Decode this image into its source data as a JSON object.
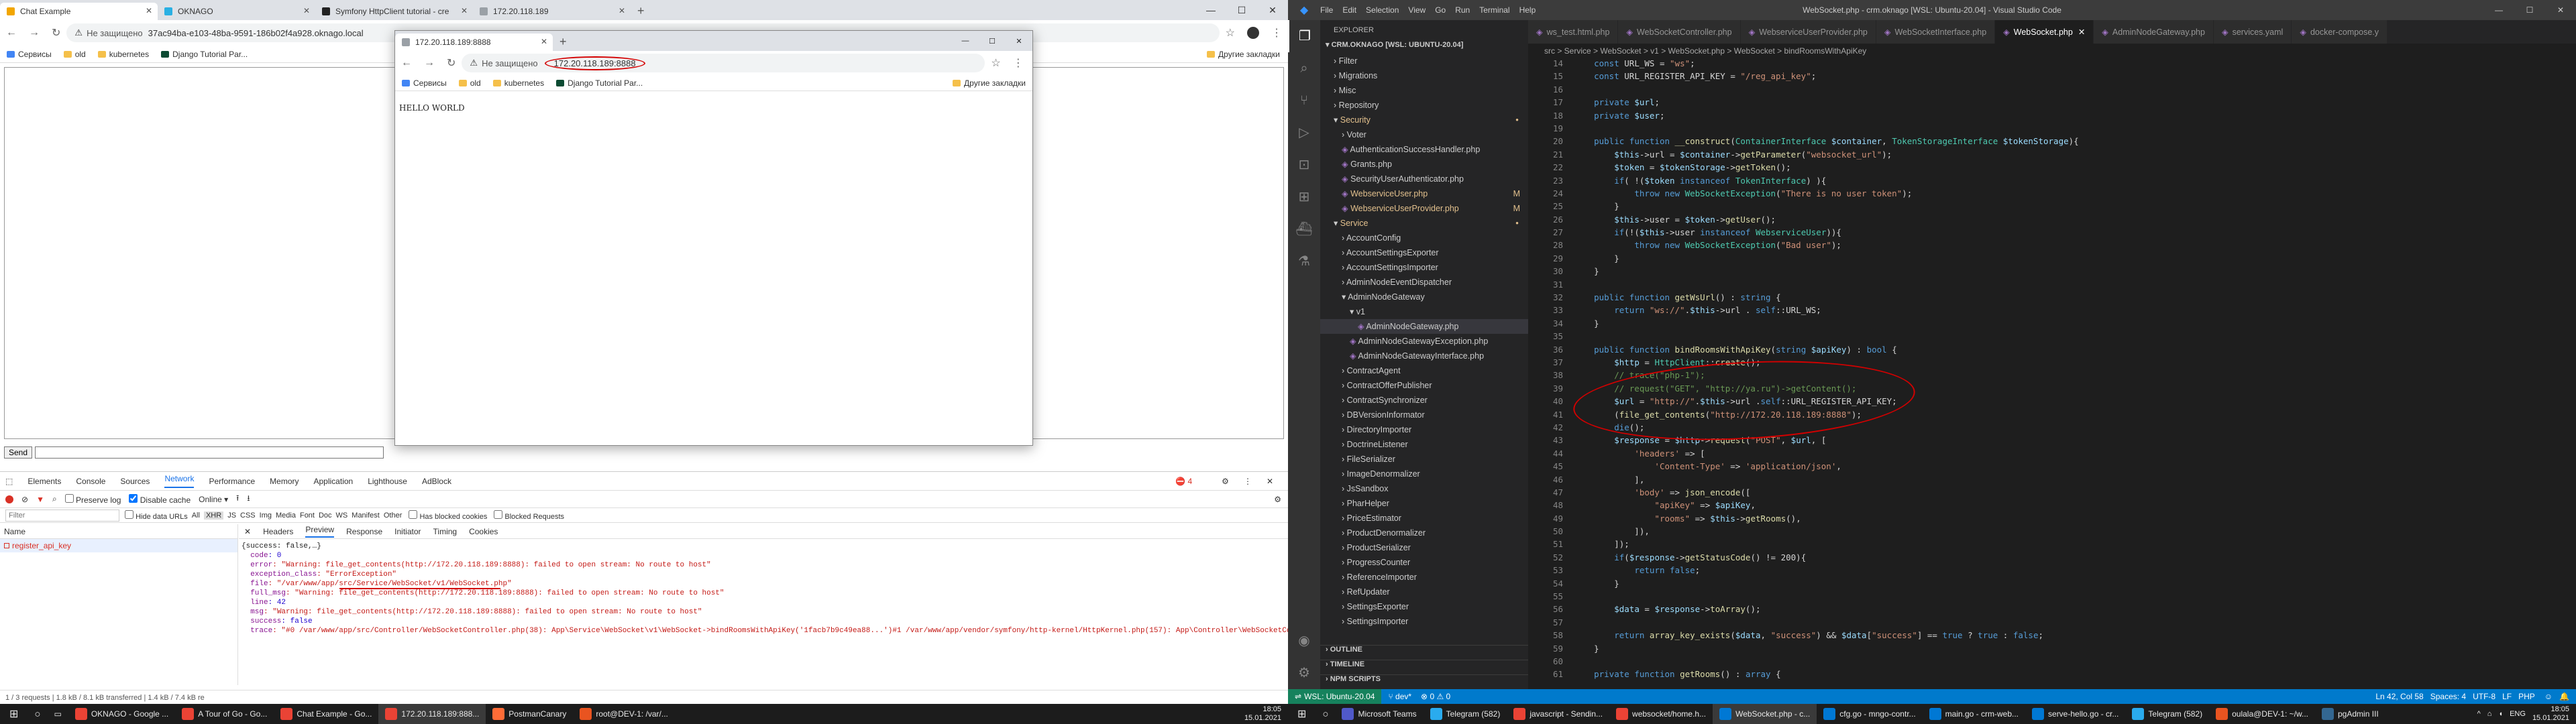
{
  "screen1": {
    "tabs": [
      {
        "title": "Chat Example",
        "active": true
      },
      {
        "title": "OKNAGO"
      },
      {
        "title": "Symfony HttpClient tutorial - cre"
      },
      {
        "title": "172.20.118.189"
      }
    ],
    "address": "37ac94ba-e103-48ba-9591-186b02f4a928.oknago.local",
    "security": "Не защищено",
    "bookmarks": [
      "Сервисы",
      "old",
      "kubernetes",
      "Django Tutorial Par..."
    ],
    "other_bookmarks": "Другие закладки",
    "send_label": "Send",
    "popup": {
      "tab_title": "172.20.118.189:8888",
      "security": "Не защищено",
      "address": "172.20.118.189:8888",
      "bookmarks": [
        "Сервисы",
        "old",
        "kubernetes",
        "Django Tutorial Par..."
      ],
      "other_bookmarks": "Другие закладки",
      "body_text": "HELLO WORLD"
    },
    "devtools": {
      "tabs": [
        "Elements",
        "Console",
        "Sources",
        "Network",
        "Performance",
        "Memory",
        "Application",
        "Lighthouse",
        "AdBlock"
      ],
      "active_tab": "Network",
      "toolbar": {
        "preserve_log": "Preserve log",
        "disable_cache": "Disable cache",
        "online": "Online"
      },
      "filter_placeholder": "Filter",
      "filter_types": [
        "Hide data URLs",
        "All",
        "XHR",
        "JS",
        "CSS",
        "Img",
        "Media",
        "Font",
        "Doc",
        "WS",
        "Manifest",
        "Other"
      ],
      "blocked_cookies": "Has blocked cookies",
      "blocked_requests": "Blocked Requests",
      "name_header": "Name",
      "requests": [
        "register_api_key"
      ],
      "detail_tabs": [
        "Headers",
        "Preview",
        "Response",
        "Initiator",
        "Timing",
        "Cookies"
      ],
      "active_detail": "Preview",
      "errors": "4",
      "preview_lines": [
        "{success: false,…}",
        "  code: 0",
        "  error: \"Warning: file_get_contents(http://172.20.118.189:8888): failed to open stream: No route to host\"",
        "  exception_class: \"ErrorException\"",
        "  file: \"/var/www/app/src/Service/WebSocket/v1/WebSocket.php\"",
        "  full_msg: \"Warning: file_get_contents(http://172.20.118.189:8888): failed to open stream: No route to host\"",
        "  line: 42",
        "  msg: \"Warning: file_get_contents(http://172.20.118.189:8888): failed to open stream: No route to host\"",
        "  success: false",
        "  trace: \"#0 /var/www/app/src/Controller/WebSocketController.php(38): App\\Service\\WebSocket\\v1\\WebSocket->bindRoomsWithApiKey('1facb7b9c49ea88...')#1 /var/www/app/vendor/symfony/http-kernel/HttpKernel.php(157): App\\Controller\\WebSocketContro"
      ],
      "status": "1 / 3 requests  |  1.8 kB / 8.1 kB transferred  |  1.4 kB / 7.4 kB re"
    },
    "taskbar": {
      "apps": [
        "OKNAGO - Google ...",
        "A Tour of Go - Go...",
        "Chat Example - Go...",
        "172.20.118.189:888...",
        "PostmanCanary",
        "root@DEV-1: /var/..."
      ],
      "time": "18:05",
      "date": "15.01.2021"
    }
  },
  "screen2": {
    "title": "WebSocket.php - crm.oknago [WSL: Ubuntu-20.04] - Visual Studio Code",
    "menu": [
      "File",
      "Edit",
      "Selection",
      "View",
      "Go",
      "Run",
      "Terminal",
      "Help"
    ],
    "explorer_label": "EXPLORER",
    "workspace": "CRM.OKNAGO [WSL: UBUNTU-20.04]",
    "tree": [
      {
        "label": "Filter",
        "depth": 1
      },
      {
        "label": "Migrations",
        "depth": 1
      },
      {
        "label": "Misc",
        "depth": 1
      },
      {
        "label": "Repository",
        "depth": 1
      },
      {
        "label": "Security",
        "depth": 1,
        "open": true,
        "git": true
      },
      {
        "label": "Voter",
        "depth": 2
      },
      {
        "label": "AuthenticationSuccessHandler.php",
        "depth": 2
      },
      {
        "label": "Grants.php",
        "depth": 2
      },
      {
        "label": "SecurityUserAuthenticator.php",
        "depth": 2
      },
      {
        "label": "WebserviceUser.php",
        "depth": 2,
        "git": true,
        "badge": "M"
      },
      {
        "label": "WebserviceUserProvider.php",
        "depth": 2,
        "git": true,
        "badge": "M"
      },
      {
        "label": "Service",
        "depth": 1,
        "open": true,
        "git": true
      },
      {
        "label": "AccountConfig",
        "depth": 2
      },
      {
        "label": "AccountSettingsExporter",
        "depth": 2
      },
      {
        "label": "AccountSettingsImporter",
        "depth": 2
      },
      {
        "label": "AdminNodeEventDispatcher",
        "depth": 2
      },
      {
        "label": "AdminNodeGateway",
        "depth": 2,
        "open": true
      },
      {
        "label": "v1",
        "depth": 3,
        "open": true
      },
      {
        "label": "AdminNodeGateway.php",
        "depth": 4,
        "selected": true
      },
      {
        "label": "AdminNodeGatewayException.php",
        "depth": 3
      },
      {
        "label": "AdminNodeGatewayInterface.php",
        "depth": 3
      },
      {
        "label": "ContractAgent",
        "depth": 2
      },
      {
        "label": "ContractOfferPublisher",
        "depth": 2
      },
      {
        "label": "ContractSynchronizer",
        "depth": 2
      },
      {
        "label": "DBVersionInformator",
        "depth": 2
      },
      {
        "label": "DirectoryImporter",
        "depth": 2
      },
      {
        "label": "DoctrineListener",
        "depth": 2
      },
      {
        "label": "FileSerializer",
        "depth": 2
      },
      {
        "label": "ImageDenormalizer",
        "depth": 2
      },
      {
        "label": "JsSandbox",
        "depth": 2
      },
      {
        "label": "PharHelper",
        "depth": 2
      },
      {
        "label": "PriceEstimator",
        "depth": 2
      },
      {
        "label": "ProductDenormalizer",
        "depth": 2
      },
      {
        "label": "ProductSerializer",
        "depth": 2
      },
      {
        "label": "ProgressCounter",
        "depth": 2
      },
      {
        "label": "ReferenceImporter",
        "depth": 2
      },
      {
        "label": "RefUpdater",
        "depth": 2
      },
      {
        "label": "SettingsExporter",
        "depth": 2
      },
      {
        "label": "SettingsImporter",
        "depth": 2
      }
    ],
    "outline": [
      "OUTLINE",
      "TIMELINE",
      "NPM SCRIPTS"
    ],
    "tabs": [
      {
        "title": "ws_test.html.php"
      },
      {
        "title": "WebSocketController.php"
      },
      {
        "title": "WebserviceUserProvider.php"
      },
      {
        "title": "WebSocketInterface.php"
      },
      {
        "title": "WebSocket.php",
        "active": true
      },
      {
        "title": "AdminNodeGateway.php"
      },
      {
        "title": "services.yaml"
      },
      {
        "title": "docker-compose.y"
      }
    ],
    "breadcrumb": "src > Service > WebSocket > v1 > WebSocket.php > WebSocket > bindRoomsWithApiKey",
    "code": [
      {
        "n": "14",
        "t": "    const URL_WS = \"ws\";"
      },
      {
        "n": "15",
        "t": "    const URL_REGISTER_API_KEY = \"/reg_api_key\";"
      },
      {
        "n": "16",
        "t": ""
      },
      {
        "n": "17",
        "t": "    private $url;"
      },
      {
        "n": "18",
        "t": "    private $user;"
      },
      {
        "n": "19",
        "t": ""
      },
      {
        "n": "20",
        "t": "    public function __construct(ContainerInterface $container, TokenStorageInterface $tokenStorage){"
      },
      {
        "n": "21",
        "t": "        $this->url = $container->getParameter(\"websocket_url\");"
      },
      {
        "n": "22",
        "t": "        $token = $tokenStorage->getToken();"
      },
      {
        "n": "23",
        "t": "        if( !($token instanceof TokenInterface) ){"
      },
      {
        "n": "24",
        "t": "            throw new WebSocketException(\"There is no user token\");"
      },
      {
        "n": "25",
        "t": "        }"
      },
      {
        "n": "26",
        "t": "        $this->user = $token->getUser();"
      },
      {
        "n": "27",
        "t": "        if(!($this->user instanceof WebserviceUser)){"
      },
      {
        "n": "28",
        "t": "            throw new WebSocketException(\"Bad user\");"
      },
      {
        "n": "29",
        "t": "        }"
      },
      {
        "n": "30",
        "t": "    }"
      },
      {
        "n": "31",
        "t": ""
      },
      {
        "n": "32",
        "t": "    public function getWsUrl() : string {"
      },
      {
        "n": "33",
        "t": "        return \"ws://\".$this->url . self::URL_WS;"
      },
      {
        "n": "34",
        "t": "    }"
      },
      {
        "n": "35",
        "t": ""
      },
      {
        "n": "36",
        "t": "    public function bindRoomsWithApiKey(string $apiKey) : bool {"
      },
      {
        "n": "37",
        "t": "        $http = HttpClient::create();"
      },
      {
        "n": "38",
        "t": "        // trace(\"php-1\");"
      },
      {
        "n": "39",
        "t": "        // request(\"GET\", \"http://ya.ru\")->getContent();"
      },
      {
        "n": "40",
        "t": "        $url = \"http://\".$this->url .self::URL_REGISTER_API_KEY;"
      },
      {
        "n": "41",
        "t": "        (file_get_contents(\"http://172.20.118.189:8888\");"
      },
      {
        "n": "42",
        "t": "        die();"
      },
      {
        "n": "43",
        "t": "        $response = $http->request(\"POST\", $url, ["
      },
      {
        "n": "44",
        "t": "            'headers' => ["
      },
      {
        "n": "45",
        "t": "                'Content-Type' => 'application/json',"
      },
      {
        "n": "46",
        "t": "            ],"
      },
      {
        "n": "47",
        "t": "            'body' => json_encode(["
      },
      {
        "n": "48",
        "t": "                \"apiKey\" => $apiKey,"
      },
      {
        "n": "49",
        "t": "                \"rooms\" => $this->getRooms(),"
      },
      {
        "n": "50",
        "t": "            ]),"
      },
      {
        "n": "51",
        "t": "        ]);"
      },
      {
        "n": "52",
        "t": "        if($response->getStatusCode() != 200){"
      },
      {
        "n": "53",
        "t": "            return false;"
      },
      {
        "n": "54",
        "t": "        }"
      },
      {
        "n": "55",
        "t": ""
      },
      {
        "n": "56",
        "t": "        $data = $response->toArray();"
      },
      {
        "n": "57",
        "t": ""
      },
      {
        "n": "58",
        "t": "        return array_key_exists($data, \"success\") && $data[\"success\"] == true ? true : false;"
      },
      {
        "n": "59",
        "t": "    }"
      },
      {
        "n": "60",
        "t": ""
      },
      {
        "n": "61",
        "t": "    private function getRooms() : array {"
      }
    ],
    "status": {
      "wsl": "WSL: Ubuntu-20.04",
      "branch": "dev*",
      "errors": "0 ⚠ 0",
      "right": "Ln 42, Col 58   Spaces: 4   UTF-8   LF   PHP"
    },
    "taskbar": {
      "apps": [
        "Microsoft Teams",
        "Telegram (582)",
        "javascript - Sendin...",
        "websocket/home.h...",
        "WebSocket.php - c...",
        "cfg.go - mngo-contr...",
        "main.go - crm-web...",
        "serve-hello.go - cr...",
        "Telegram (582)",
        "oulala@DEV-1: ~/w...",
        "pgAdmin III"
      ],
      "lang": "ENG",
      "time": "18:05",
      "date": "15.01.2021"
    }
  },
  "colors": {
    "chrome_tabbar": "#dee1e6",
    "vscode_bg": "#1e1e1e",
    "vscode_status": "#007acc",
    "annotation_red": "#d40000"
  }
}
